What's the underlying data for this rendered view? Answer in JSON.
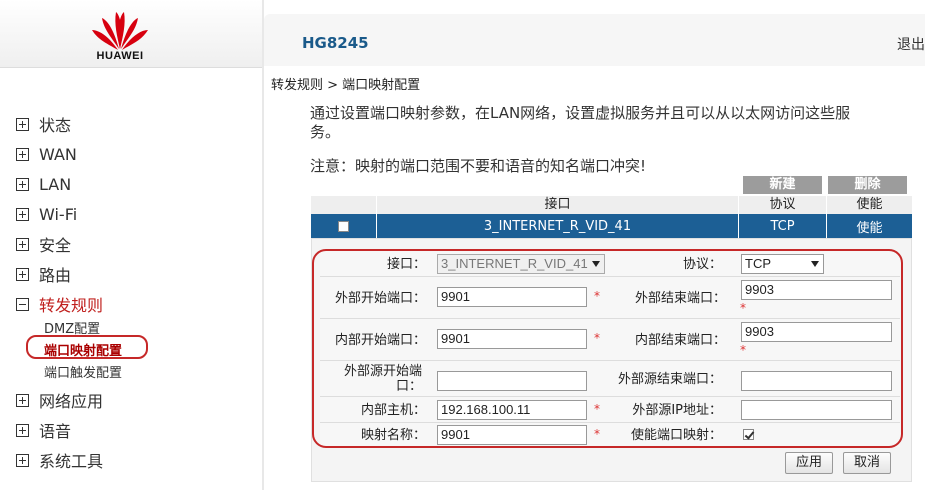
{
  "brand": {
    "name": "HUAWEI",
    "model": "HG8245",
    "logout": "退出"
  },
  "menu": [
    {
      "label": "状态",
      "state": "collapsed"
    },
    {
      "label": "WAN",
      "state": "collapsed"
    },
    {
      "label": "LAN",
      "state": "collapsed"
    },
    {
      "label": "Wi-Fi",
      "state": "collapsed"
    },
    {
      "label": "安全",
      "state": "collapsed"
    },
    {
      "label": "路由",
      "state": "collapsed"
    },
    {
      "label": "转发规则",
      "state": "expanded"
    },
    {
      "label": "网络应用",
      "state": "collapsed"
    },
    {
      "label": "语音",
      "state": "collapsed"
    },
    {
      "label": "系统工具",
      "state": "collapsed"
    }
  ],
  "submenu": [
    {
      "label": "DMZ配置"
    },
    {
      "label": "端口映射配置",
      "selected": true
    },
    {
      "label": "端口触发配置"
    }
  ],
  "breadcrumb": "转发规则 > 端口映射配置",
  "description": "通过设置端口映射参数，在LAN网络，设置虚拟服务并且可以从以太网访问这些服务。",
  "notice": "注意：映射的端口范围不要和语音的知名端口冲突!",
  "table_buttons": {
    "new": "新建",
    "delete": "删除"
  },
  "table": {
    "headers": [
      "",
      "接口",
      "协议",
      "使能"
    ],
    "rows": [
      {
        "checked": false,
        "interface": "3_INTERNET_R_VID_41",
        "protocol": "TCP",
        "enable": "使能"
      }
    ]
  },
  "form": {
    "interface_label": "接口：",
    "interface_value": "3_INTERNET_R_VID_41",
    "protocol_label": "协议：",
    "protocol_value": "TCP",
    "ext_start_label": "外部开始端口：",
    "ext_start_value": "9901",
    "ext_end_label": "外部结束端口：",
    "ext_end_value": "9903",
    "int_start_label": "内部开始端口：",
    "int_start_value": "9901",
    "int_end_label": "内部结束端口：",
    "int_end_value": "9903",
    "src_start_label": "外部源开始端口：",
    "src_start_value": "",
    "src_end_label": "外部源结束端口：",
    "src_end_value": "",
    "host_label": "内部主机：",
    "host_value": "192.168.100.11",
    "src_ip_label": "外部源IP地址：",
    "src_ip_value": "",
    "name_label": "映射名称：",
    "name_value": "9901",
    "enable_label": "使能端口映射：",
    "enable_checked": true,
    "required_mark": "*"
  },
  "buttons": {
    "apply": "应用",
    "cancel": "取消"
  },
  "colors": {
    "brand_red": "#c7000b",
    "selected_row": "#1c5f95",
    "annotation_ring": "#c62828"
  }
}
